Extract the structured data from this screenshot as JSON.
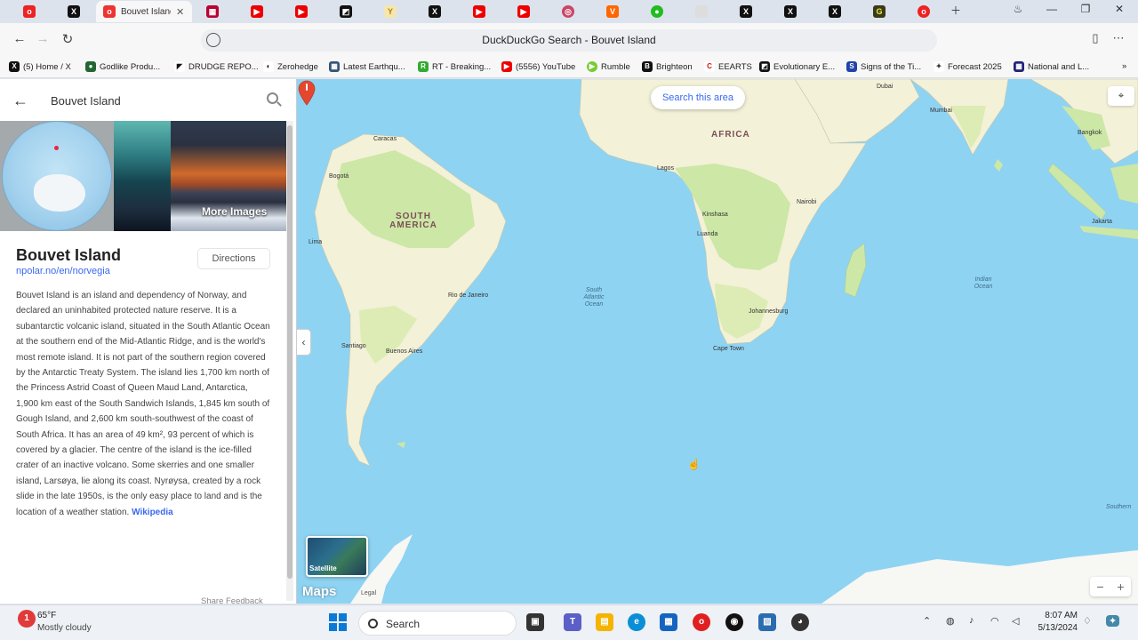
{
  "browser": {
    "active_tab_title": "Bouvet Island",
    "window_title": "DuckDuckGo Search - Bouvet Island",
    "tab_favicons": [
      "opera-icon",
      "x-icon",
      "red-icon",
      "flag-icon",
      "youtube-icon",
      "youtube-icon",
      "tiktok-icon",
      "vivaldi-icon",
      "x-icon",
      "youtube-icon",
      "youtube-icon",
      "mastodon-icon",
      "brave-icon",
      "whatsapp-icon",
      "blank-icon",
      "x-icon",
      "x-icon",
      "x-icon",
      "gab-icon",
      "opera-icon"
    ],
    "bookmarks": [
      {
        "label": "(5) Home / X",
        "icon": "x-icon"
      },
      {
        "label": "Godlike Produ...",
        "icon": "shield-icon"
      },
      {
        "label": "DRUDGE REPO...",
        "icon": "drudge-icon"
      },
      {
        "label": "Zerohedge",
        "icon": "zerohedge-icon"
      },
      {
        "label": "Latest Earthqu...",
        "icon": "earthquake-icon"
      },
      {
        "label": "RT - Breaking...",
        "icon": "rt-icon"
      },
      {
        "label": "(5556) YouTube",
        "icon": "youtube-icon"
      },
      {
        "label": "Rumble",
        "icon": "rumble-icon"
      },
      {
        "label": "Brighteon",
        "icon": "brighteon-icon"
      },
      {
        "label": "EEARTS",
        "icon": "eearts-icon"
      },
      {
        "label": "Evolutionary E...",
        "icon": "evolutionary-icon"
      },
      {
        "label": "Signs of the Ti...",
        "icon": "signs-icon"
      },
      {
        "label": "Forecast 2025",
        "icon": "forecast-icon"
      },
      {
        "label": "National and L...",
        "icon": "national-icon"
      }
    ]
  },
  "panel": {
    "search_value": "Bouvet Island",
    "more_images": "More Images",
    "title": "Bouvet Island",
    "link": "npolar.no/en/norvegia",
    "directions": "Directions",
    "description": "Bouvet Island is an island and dependency of Norway, and declared an uninhabited protected nature reserve. It is a subantarctic volcanic island, situated in the South Atlantic Ocean at the southern end of the Mid-Atlantic Ridge, and is the world's most remote island. It is not part of the southern region covered by the Antarctic Treaty System. The island lies 1,700 km north of the Princess Astrid Coast of Queen Maud Land, Antarctica, 1,900 km east of the South Sandwich Islands, 1,845 km south of Gough Island, and 2,600 km south-southwest of the coast of South Africa. It has an area of 49 km², 93 percent of which is covered by a glacier. The centre of the island is the ice-filled crater of an inactive volcano. Some skerries and one smaller island, Larsøya, lie along its coast. Nyrøysa, created by a rock slide in the late 1950s, is the only easy place to land and is the location of a weather station.",
    "wiki_link": "Wikipedia",
    "share_feedback": "Share Feedback"
  },
  "map": {
    "search_area": "Search this area",
    "satellite": "Satellite",
    "maps_logo": "Maps",
    "legal": "Legal",
    "continents": {
      "africa": "AFRICA",
      "south_america": "SOUTH AMERICA"
    },
    "oceans": {
      "south_atlantic": "South Atlantic Ocean",
      "indian": "Indian Ocean",
      "southern": "Southern"
    },
    "cities": [
      "Dubai",
      "Mumbai",
      "Bangkok",
      "Caracas",
      "Bogotá",
      "Lagos",
      "Nairobi",
      "Kinshasa",
      "Luanda",
      "Lima",
      "Rio de Janeiro",
      "Johannesburg",
      "Santiago",
      "Buenos Aires",
      "Cape Town",
      "Jakarta"
    ],
    "colors": {
      "water": "#8fd3f2",
      "land": "#f3f1d8",
      "vegetation": "#cde7a6",
      "pin": "#e4472f"
    }
  },
  "taskbar": {
    "temperature": "65°F",
    "weather": "Mostly cloudy",
    "search": "Search",
    "time": "8:07 AM",
    "date": "5/13/2024"
  }
}
